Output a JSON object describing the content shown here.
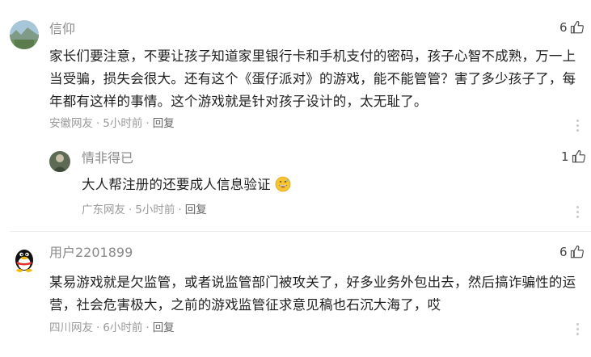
{
  "comments": [
    {
      "username": "信仰",
      "likes": "6",
      "lines": [
        "家长们要注意，不要让孩子知道家里银行卡和手机支付的密码，孩子心智不成熟，万一上",
        "当受骗，损失会很大。还有这个《蛋仔派对》的游戏，能不能管管？害了多少孩子了，每",
        "年都有这样的事情。这个游戏就是针对孩子设计的，太无耻了。"
      ],
      "location": "安徽网友",
      "time": "5小时前",
      "reply_label": "回复"
    },
    {
      "username": "情非得已",
      "likes": "1",
      "text": "大人帮注册的还要成人信息验证",
      "emoji": "grinning-sweat-emoji",
      "location": "广东网友",
      "time": "5小时前",
      "reply_label": "回复"
    },
    {
      "username": "用户2201899",
      "likes": "6",
      "lines": [
        "某易游戏就是欠监管，或者说监管部门被攻关了，好多业务外包出去，然后搞诈骗性的运",
        "营，社会危害极大，之前的游戏监管征求意见稿也石沉大海了，哎"
      ],
      "location": "四川网友",
      "time": "6小时前",
      "reply_label": "回复"
    }
  ],
  "separator": "·",
  "icons": {
    "like": "thumbs-up-icon",
    "more": "more-vertical-icon"
  },
  "colors": {
    "text": "#1f1f1f",
    "muted": "#9a9a9a",
    "username": "#8a8a8a"
  }
}
